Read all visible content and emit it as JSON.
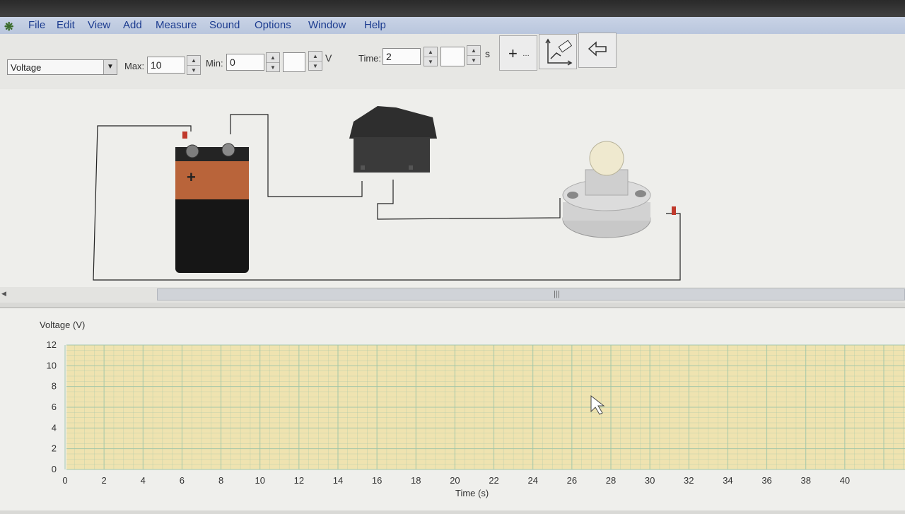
{
  "menu": {
    "items": [
      "File",
      "Edit",
      "View",
      "Add",
      "Measure",
      "Sound",
      "Options",
      "Window",
      "Help"
    ]
  },
  "toolbar": {
    "quantity": "Voltage",
    "max_label": "Max:",
    "max_value": "10",
    "min_label": "Min:",
    "min_value": "0",
    "volt_unit": "V",
    "time_label": "Time:",
    "time_value": "2",
    "time_unit": "s",
    "add_button": "+"
  },
  "circuit": {
    "battery_sign": "+"
  },
  "graph": {
    "y_label": "Voltage (V)",
    "x_label": "Time (s)",
    "y_ticks": [
      "0",
      "2",
      "4",
      "6",
      "8",
      "10",
      "12"
    ],
    "x_ticks": [
      "0",
      "2",
      "4",
      "6",
      "8",
      "10",
      "12",
      "14",
      "16",
      "18",
      "20",
      "22",
      "24",
      "26",
      "28",
      "30",
      "32",
      "34",
      "36",
      "38",
      "40"
    ],
    "grid_color": "#9ec5a8",
    "paper_color": "#efe3b0"
  }
}
